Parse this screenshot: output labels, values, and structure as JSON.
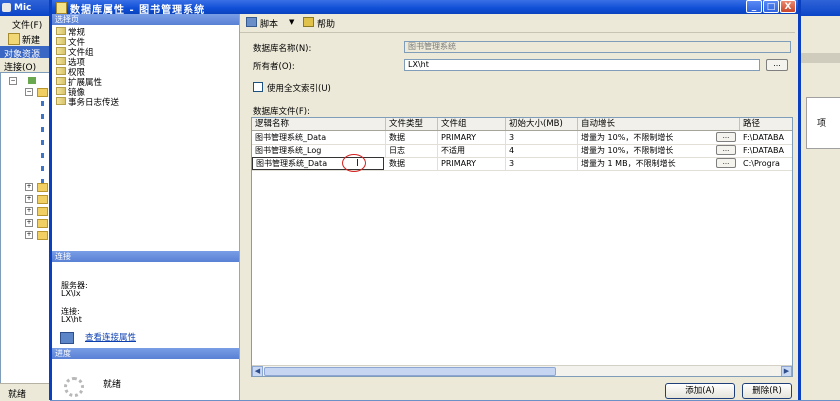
{
  "background_app": {
    "title": "Mic",
    "menu_file": "文件(F)",
    "toolbar_new": "新建",
    "object_explorer_title": "对象资源",
    "connect_label": "连接(O)",
    "status": "就绪",
    "right_tab_label": "项"
  },
  "dialog": {
    "title": "数据库属性 - 图书管理系统",
    "window_buttons": {
      "minimize": "_",
      "maximize": "□",
      "close": "X"
    },
    "left_pane": {
      "select_page_header": "选择页",
      "pages": [
        "常规",
        "文件",
        "文件组",
        "选项",
        "权限",
        "扩展属性",
        "镜像",
        "事务日志传送"
      ],
      "connection_header": "连接",
      "server_label": "服务器:",
      "server_value": "LX\\lx",
      "connection_label": "连接:",
      "connection_value": "LX\\ht",
      "view_connection_link": "查看连接属性",
      "progress_header": "进度",
      "progress_status": "就绪"
    },
    "toolbar": {
      "script_label": "脚本",
      "help_label": "帮助"
    },
    "form": {
      "db_name_label": "数据库名称(N):",
      "db_name_value": "图书管理系统",
      "owner_label": "所有者(O):",
      "owner_value": "LX\\ht",
      "browse_label": "...",
      "fulltext_label": "使用全文索引(U)",
      "fulltext_checked": false,
      "db_files_label": "数据库文件(F):"
    },
    "grid": {
      "columns": [
        "逻辑名称",
        "文件类型",
        "文件组",
        "初始大小(MB)",
        "自动增长",
        "路径"
      ],
      "rows": [
        {
          "name": "图书管理系统_Data",
          "type": "数据",
          "group": "PRIMARY",
          "size": "3",
          "growth": "增量为 10%，不限制增长",
          "path": "F:\\DATABA"
        },
        {
          "name": "图书管理系统_Log",
          "type": "日志",
          "group": "不适用",
          "size": "4",
          "growth": "增量为 10%，不限制增长",
          "path": "F:\\DATABA"
        },
        {
          "name": "图书管理系统_Data",
          "type": "数据",
          "group": "PRIMARY",
          "size": "3",
          "growth": "增量为 1 MB，不限制增长",
          "path": "C:\\Progra"
        }
      ],
      "dots_label": "..."
    },
    "buttons": {
      "add": "添加(A)",
      "remove": "删除(R)"
    }
  }
}
